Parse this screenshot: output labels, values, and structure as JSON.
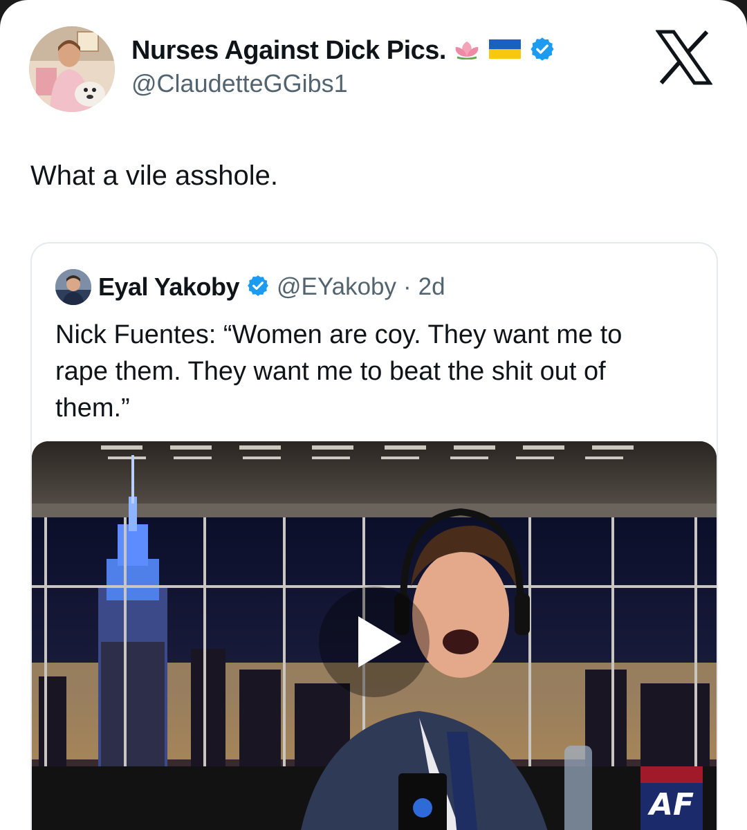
{
  "author": {
    "display_name": "Nurses Against Dick Pics.",
    "handle": "@ClaudetteGGibs1",
    "badges": [
      "lotus-emoji",
      "ukraine-flag-emoji",
      "verified-badge-icon"
    ]
  },
  "tweet": {
    "text": "What a vile asshole."
  },
  "quoted": {
    "display_name": "Eyal Yakoby",
    "handle": "@EYakoby",
    "separator": "·",
    "time": "2d",
    "lines": [
      "Nick Fuentes: “Women are coy. They want me to",
      "rape them. They want me to beat the shit out of",
      "them.”"
    ],
    "media": {
      "kind": "video",
      "play_icon": "play-icon",
      "logo_text": "AF"
    }
  },
  "brand": {
    "logo": "x-logo-icon"
  },
  "colors": {
    "verified": "#1d9bf0",
    "handle": "#536471",
    "text": "#0f1419"
  }
}
